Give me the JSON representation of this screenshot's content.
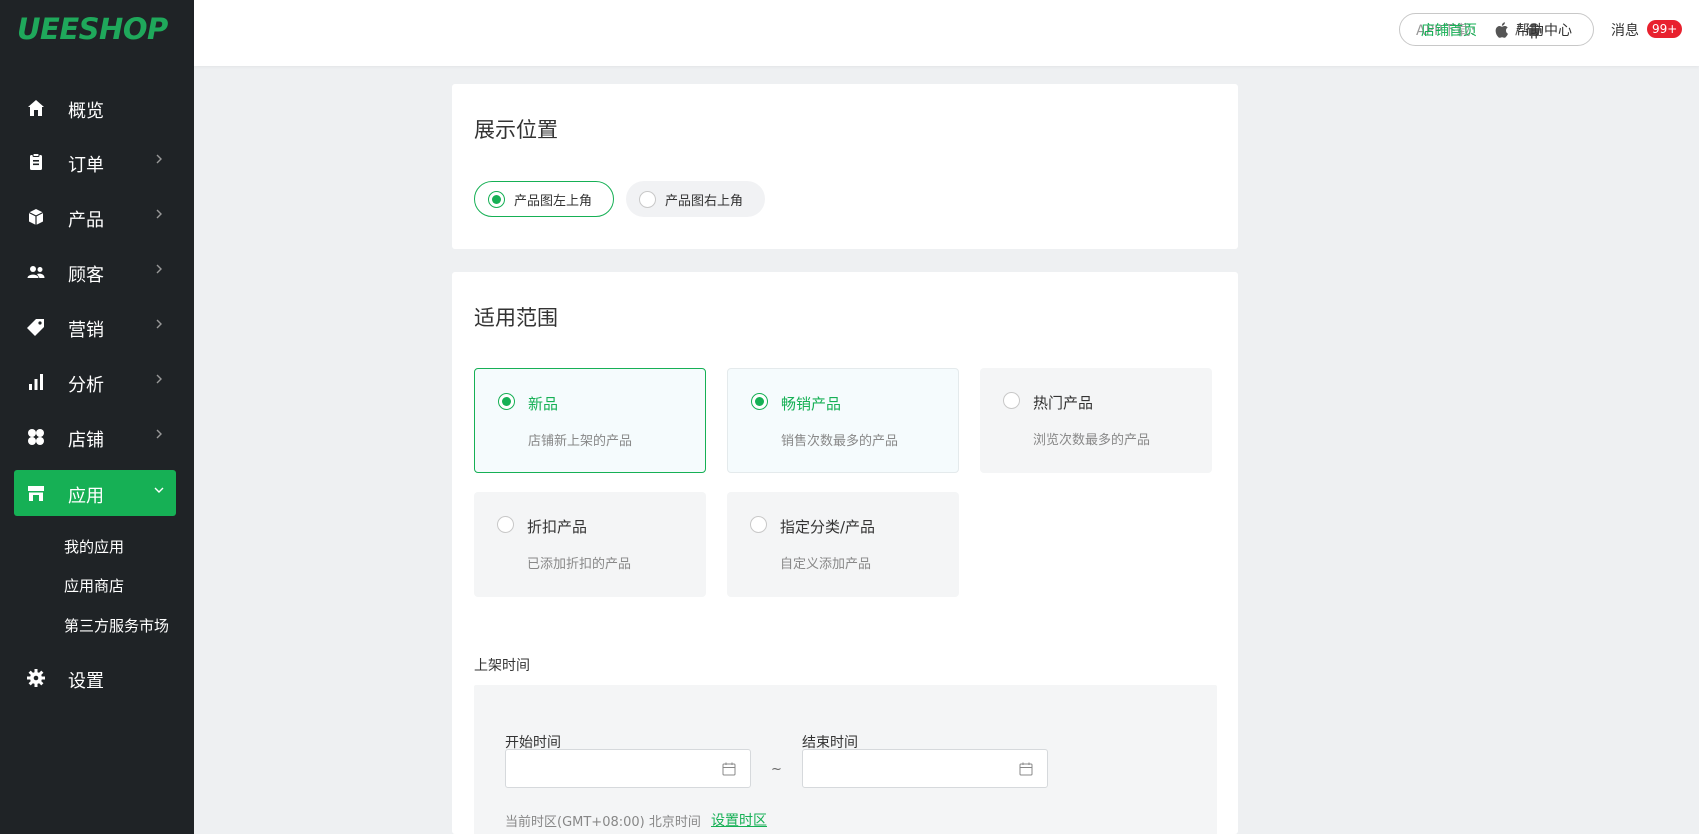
{
  "brand": {
    "logo": "UEESHOP",
    "accent": "#16b055"
  },
  "sidebar": {
    "items": [
      {
        "label": "概览",
        "icon": "home-icon"
      },
      {
        "label": "订单",
        "icon": "clipboard-icon"
      },
      {
        "label": "产品",
        "icon": "box-icon"
      },
      {
        "label": "顾客",
        "icon": "users-icon"
      },
      {
        "label": "营销",
        "icon": "tag-icon"
      },
      {
        "label": "分析",
        "icon": "bar-chart-icon"
      },
      {
        "label": "店铺",
        "icon": "grid-icon"
      },
      {
        "label": "应用",
        "icon": "store-icon"
      },
      {
        "label": "设置",
        "icon": "gear-icon"
      }
    ],
    "subitems": [
      "我的应用",
      "应用商店",
      "第三方服务市场"
    ]
  },
  "topbar": {
    "app_download": "APP下载:",
    "app_sep": "/",
    "store_home": "店铺首页",
    "help": "帮助中心",
    "messages": "消息",
    "badge": "99+"
  },
  "display_position": {
    "title": "展示位置",
    "options": [
      "产品图左上角",
      "产品图右上角"
    ],
    "selected": 0
  },
  "scope": {
    "title": "适用范围",
    "options": [
      {
        "title": "新品",
        "desc": "店铺新上架的产品",
        "checked": true
      },
      {
        "title": "畅销产品",
        "desc": "销售次数最多的产品",
        "checked": true
      },
      {
        "title": "热门产品",
        "desc": "浏览次数最多的产品",
        "checked": false
      },
      {
        "title": "折扣产品",
        "desc": "已添加折扣的产品",
        "checked": false
      },
      {
        "title": "指定分类/产品",
        "desc": "自定义添加产品",
        "checked": false
      }
    ]
  },
  "listing_time": {
    "label": "上架时间",
    "start_label": "开始时间",
    "end_label": "结束时间",
    "start_value": "",
    "end_value": "",
    "separator": "~",
    "timezone_text": "当前时区(GMT+08:00) 北京时间",
    "set_timezone": "设置时区"
  }
}
